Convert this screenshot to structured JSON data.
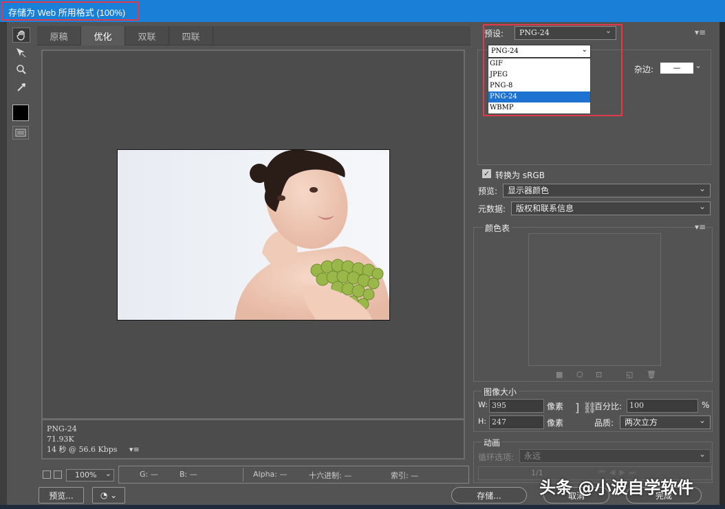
{
  "window": {
    "title": "存储为 Web 所用格式 (100%)"
  },
  "tools": [
    {
      "icon": "hand-icon"
    },
    {
      "icon": "slice-select-icon"
    },
    {
      "icon": "zoom-icon"
    },
    {
      "icon": "eyedropper-icon"
    }
  ],
  "tabs": [
    {
      "label": "原稿"
    },
    {
      "label": "优化"
    },
    {
      "label": "双联"
    },
    {
      "label": "四联"
    }
  ],
  "active_tab": "优化",
  "info": {
    "format": "PNG-24",
    "size": "71.93K",
    "time": "14 秒 @ 56.6 Kbps"
  },
  "bottom": {
    "zoom": "100%",
    "r": "G: —",
    "b": "B: —",
    "alpha": "Alpha: —",
    "hex": "十六进制: —",
    "index": "索引: —",
    "preview_button": "预览..."
  },
  "buttons": {
    "save": "存储...",
    "cancel": "取消",
    "done": "完成"
  },
  "preset": {
    "label": "预设:",
    "value": "PNG-24"
  },
  "format_select": {
    "value": "PNG-24",
    "options": [
      "GIF",
      "JPEG",
      "PNG-8",
      "PNG-24",
      "WBMP"
    ],
    "selected": "PNG-24"
  },
  "matte": {
    "label": "杂边:",
    "value": "—"
  },
  "convert_srgb": {
    "label": "转换为 sRGB",
    "checked": true
  },
  "preview": {
    "label": "预览:",
    "value": "显示器颜色"
  },
  "metadata": {
    "label": "元数据:",
    "value": "版权和联系信息"
  },
  "color_table": {
    "label": "颜色表"
  },
  "image_size": {
    "label": "图像大小",
    "w_label": "W:",
    "w": "395",
    "h_label": "H:",
    "h": "247",
    "unit": "像素",
    "percent_label": "百分比:",
    "percent": "100",
    "percent_unit": "%",
    "quality_label": "品质:",
    "quality": "两次立方"
  },
  "animation": {
    "label": "动画",
    "loop_label": "循环选项:",
    "loop": "永远",
    "frame": "1/1"
  },
  "watermark": "头条 @小波自学软件"
}
